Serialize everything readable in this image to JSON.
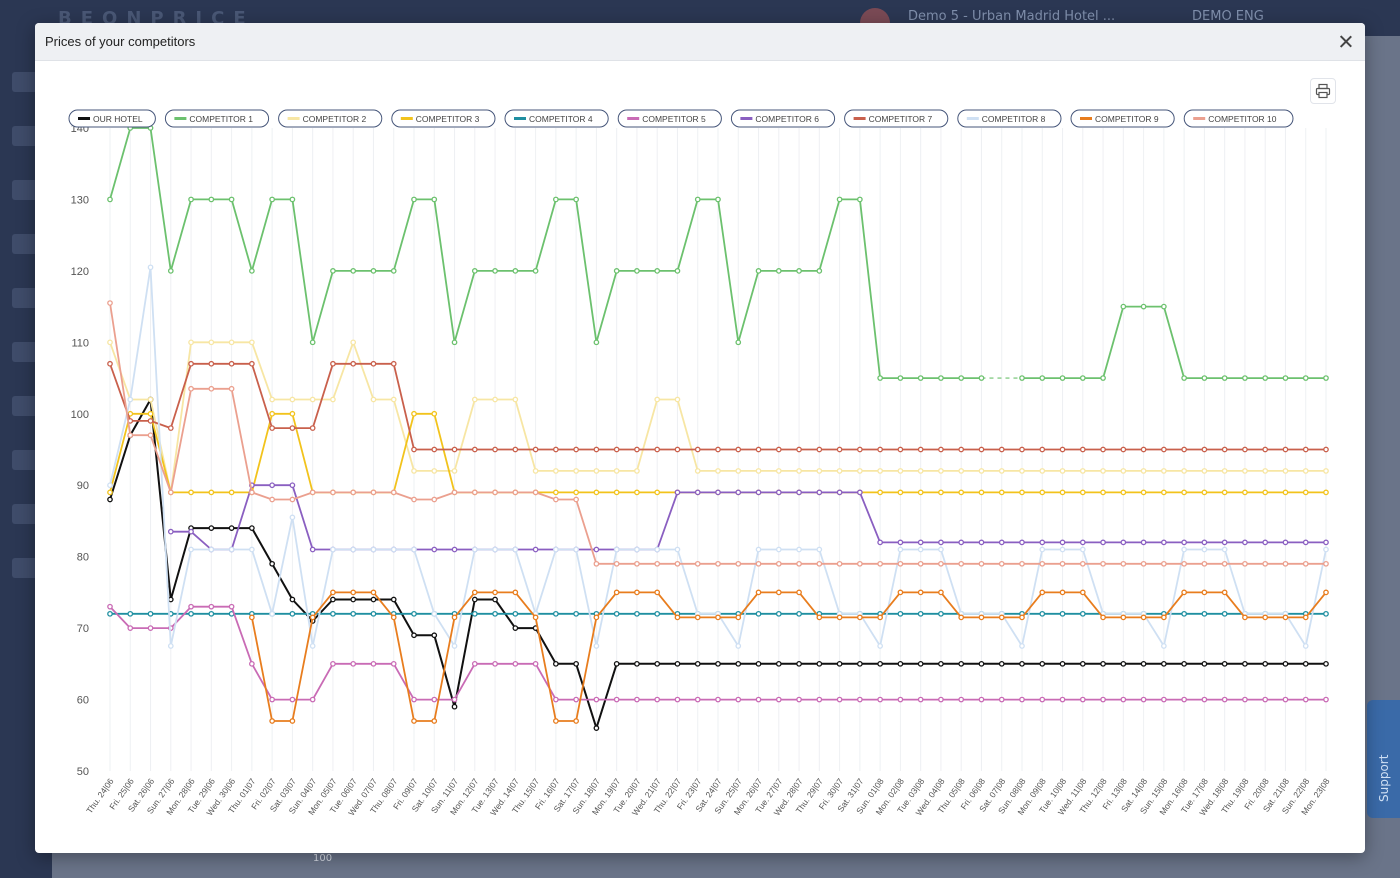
{
  "modal": {
    "title": "Prices of your competitors"
  },
  "background": {
    "hotel_name": "Demo 5 - Urban Madrid Hotel ...",
    "user_label": "DEMO ENG",
    "support_label": "Support",
    "stray_label": "100"
  },
  "icons": {
    "close": "close-icon",
    "print": "printer-icon"
  },
  "chart_data": {
    "type": "line",
    "title": "",
    "xlabel": "",
    "ylabel": "",
    "ylim": [
      50,
      140
    ],
    "yticks": [
      50,
      60,
      70,
      80,
      90,
      100,
      110,
      120,
      130,
      140
    ],
    "grid": "vertical",
    "legend_position": "top-left",
    "categories": [
      "Thu. 24|06",
      "Fri. 25|06",
      "Sat. 26|06",
      "Sun. 27|06",
      "Mon. 28|06",
      "Tue. 29|06",
      "Wed. 30|06",
      "Thu. 01|07",
      "Fri. 02|07",
      "Sat. 03|07",
      "Sun. 04|07",
      "Mon. 05|07",
      "Tue. 06|07",
      "Wed. 07|07",
      "Thu. 08|07",
      "Fri. 09|07",
      "Sat. 10|07",
      "Sun. 11|07",
      "Mon. 12|07",
      "Tue. 13|07",
      "Wed. 14|07",
      "Thu. 15|07",
      "Fri. 16|07",
      "Sat. 17|07",
      "Sun. 18|07",
      "Mon. 19|07",
      "Tue. 20|07",
      "Wed. 21|07",
      "Thu. 22|07",
      "Fri. 23|07",
      "Sat. 24|07",
      "Sun. 25|07",
      "Mon. 26|07",
      "Tue. 27|07",
      "Wed. 28|07",
      "Thu. 29|07",
      "Fri. 30|07",
      "Sat. 31|07",
      "Sun. 01|08",
      "Mon. 02|08",
      "Tue. 03|08",
      "Wed. 04|08",
      "Thu. 05|08",
      "Fri. 06|08",
      "Sat. 07|08",
      "Sun. 08|08",
      "Mon. 09|08",
      "Tue. 10|08",
      "Wed. 11|08",
      "Thu. 12|08",
      "Fri. 13|08",
      "Sat. 14|08",
      "Sun. 15|08",
      "Mon. 16|08",
      "Tue. 17|08",
      "Wed. 18|08",
      "Thu. 19|08",
      "Fri. 20|08",
      "Sat. 21|08",
      "Sun. 22|08",
      "Mon. 23|08"
    ],
    "series": [
      {
        "name": "OUR HOTEL",
        "color": "#111111",
        "values": [
          88,
          97,
          102,
          74,
          84,
          84,
          84,
          84,
          79,
          74,
          71,
          74,
          74,
          74,
          74,
          69,
          69,
          59,
          74,
          74,
          70,
          70,
          65,
          65,
          56,
          65,
          65,
          65,
          65,
          65,
          65,
          65,
          65,
          65,
          65,
          65,
          65,
          65,
          65,
          65,
          65,
          65,
          65,
          65,
          65,
          65,
          65,
          65,
          65,
          65,
          65,
          65,
          65,
          65,
          65,
          65,
          65,
          65,
          65,
          65,
          65
        ]
      },
      {
        "name": "COMPETITOR 1",
        "color": "#6cc16e",
        "values": [
          130,
          140,
          140,
          120,
          130,
          130,
          130,
          120,
          130,
          130,
          110,
          120,
          120,
          120,
          120,
          130,
          130,
          110,
          120,
          120,
          120,
          120,
          130,
          130,
          110,
          120,
          120,
          120,
          120,
          130,
          130,
          110,
          120,
          120,
          120,
          120,
          130,
          130,
          105,
          105,
          105,
          105,
          105,
          105,
          null,
          105,
          105,
          105,
          105,
          105,
          115,
          115,
          115,
          105,
          105,
          105,
          105,
          105,
          105,
          105,
          105
        ]
      },
      {
        "name": "COMPETITOR 2",
        "color": "#f7e6a4",
        "values": [
          110,
          102,
          102,
          89,
          110,
          110,
          110,
          110,
          102,
          102,
          102,
          102,
          110,
          102,
          102,
          92,
          92,
          92,
          102,
          102,
          102,
          92,
          92,
          92,
          92,
          92,
          92,
          102,
          102,
          92,
          92,
          92,
          92,
          92,
          92,
          92,
          92,
          92,
          92,
          92,
          92,
          92,
          92,
          92,
          92,
          92,
          92,
          92,
          92,
          92,
          92,
          92,
          92,
          92,
          92,
          92,
          92,
          92,
          92,
          92,
          92
        ]
      },
      {
        "name": "COMPETITOR 3",
        "color": "#f2c31c",
        "values": [
          89,
          100,
          100,
          89,
          89,
          89,
          89,
          89,
          100,
          100,
          89,
          89,
          89,
          89,
          89,
          100,
          100,
          89,
          89,
          89,
          89,
          89,
          89,
          89,
          89,
          89,
          89,
          89,
          89,
          89,
          89,
          89,
          89,
          89,
          89,
          89,
          89,
          89,
          89,
          89,
          89,
          89,
          89,
          89,
          89,
          89,
          89,
          89,
          89,
          89,
          89,
          89,
          89,
          89,
          89,
          89,
          89,
          89,
          89,
          89,
          89
        ]
      },
      {
        "name": "COMPETITOR 4",
        "color": "#1f8fa1",
        "values": [
          72,
          72,
          72,
          72,
          72,
          72,
          72,
          72,
          72,
          72,
          72,
          72,
          72,
          72,
          72,
          72,
          72,
          72,
          72,
          72,
          72,
          72,
          72,
          72,
          72,
          72,
          72,
          72,
          72,
          72,
          72,
          72,
          72,
          72,
          72,
          72,
          72,
          72,
          72,
          72,
          72,
          72,
          72,
          72,
          72,
          72,
          72,
          72,
          72,
          72,
          72,
          72,
          72,
          72,
          72,
          72,
          72,
          72,
          72,
          72,
          72
        ]
      },
      {
        "name": "COMPETITOR 5",
        "color": "#c96bb5",
        "values": [
          73,
          70,
          70,
          70,
          73,
          73,
          73,
          65,
          60,
          60,
          60,
          65,
          65,
          65,
          65,
          60,
          60,
          60,
          65,
          65,
          65,
          65,
          60,
          60,
          60,
          60,
          60,
          60,
          60,
          60,
          60,
          60,
          60,
          60,
          60,
          60,
          60,
          60,
          60,
          60,
          60,
          60,
          60,
          60,
          60,
          60,
          60,
          60,
          60,
          60,
          60,
          60,
          60,
          60,
          60,
          60,
          60,
          60,
          60,
          60,
          60
        ]
      },
      {
        "name": "COMPETITOR 6",
        "color": "#8a5fc1",
        "values": [
          null,
          null,
          null,
          83.5,
          83.5,
          81,
          81,
          90,
          90,
          90,
          81,
          81,
          81,
          81,
          81,
          81,
          81,
          81,
          81,
          81,
          81,
          81,
          81,
          81,
          81,
          81,
          81,
          81,
          89,
          89,
          89,
          89,
          89,
          89,
          89,
          89,
          89,
          89,
          82,
          82,
          82,
          82,
          82,
          82,
          82,
          82,
          82,
          82,
          82,
          82,
          82,
          82,
          82,
          82,
          82,
          82,
          82,
          82,
          82,
          82,
          82
        ]
      },
      {
        "name": "COMPETITOR 7",
        "color": "#c9604c",
        "values": [
          107,
          99,
          99,
          98,
          107,
          107,
          107,
          107,
          98,
          98,
          98,
          107,
          107,
          107,
          107,
          95,
          95,
          95,
          95,
          95,
          95,
          95,
          95,
          95,
          95,
          95,
          95,
          95,
          95,
          95,
          95,
          95,
          95,
          95,
          95,
          95,
          95,
          95,
          95,
          95,
          95,
          95,
          95,
          95,
          95,
          95,
          95,
          95,
          95,
          95,
          95,
          95,
          95,
          95,
          95,
          95,
          95,
          95,
          95,
          95,
          95
        ]
      },
      {
        "name": "COMPETITOR 8",
        "color": "#cfe0f3",
        "values": [
          90,
          102,
          120.5,
          67.5,
          81,
          81,
          81,
          81,
          72,
          85.5,
          67.5,
          81,
          81,
          81,
          81,
          81,
          72,
          67.5,
          81,
          81,
          81,
          72,
          81,
          81,
          67.5,
          81,
          81,
          81,
          81,
          72,
          72,
          67.5,
          81,
          81,
          81,
          81,
          72,
          72,
          67.5,
          81,
          81,
          81,
          72,
          72,
          72,
          67.5,
          81,
          81,
          81,
          72,
          72,
          72,
          67.5,
          81,
          81,
          81,
          72,
          72,
          72,
          67.5,
          81
        ]
      },
      {
        "name": "COMPETITOR 9",
        "color": "#e87d1e",
        "values": [
          null,
          null,
          null,
          null,
          null,
          null,
          null,
          71.5,
          57,
          57,
          71.5,
          75,
          75,
          75,
          71.5,
          57,
          57,
          71.5,
          75,
          75,
          75,
          71.5,
          57,
          57,
          71.5,
          75,
          75,
          75,
          71.5,
          71.5,
          71.5,
          71.5,
          75,
          75,
          75,
          71.5,
          71.5,
          71.5,
          71.5,
          75,
          75,
          75,
          71.5,
          71.5,
          71.5,
          71.5,
          75,
          75,
          75,
          71.5,
          71.5,
          71.5,
          71.5,
          75,
          75,
          75,
          71.5,
          71.5,
          71.5,
          71.5,
          75
        ]
      },
      {
        "name": "COMPETITOR 10",
        "color": "#eba08f",
        "values": [
          115.5,
          97,
          97,
          89,
          103.5,
          103.5,
          103.5,
          89,
          88,
          88,
          89,
          89,
          89,
          89,
          89,
          88,
          88,
          89,
          89,
          89,
          89,
          89,
          88,
          88,
          79,
          79,
          79,
          79,
          79,
          79,
          79,
          79,
          79,
          79,
          79,
          79,
          79,
          79,
          79,
          79,
          79,
          79,
          79,
          79,
          79,
          79,
          79,
          79,
          79,
          79,
          79,
          79,
          79,
          79,
          79,
          79,
          79,
          79,
          79,
          79,
          79
        ]
      }
    ]
  }
}
